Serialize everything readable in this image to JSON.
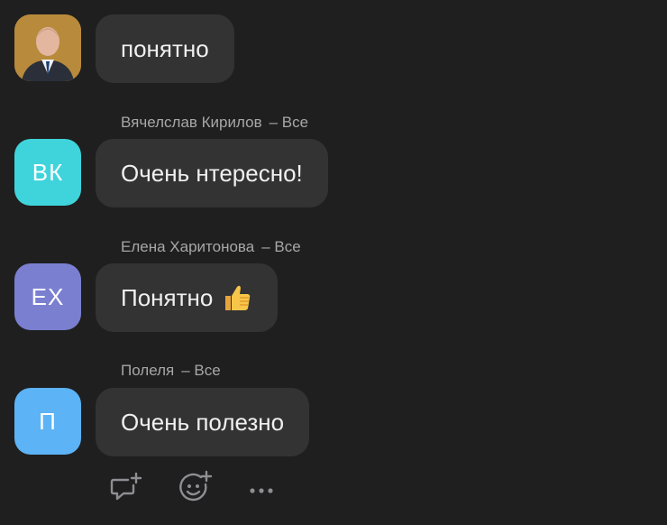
{
  "messages": [
    {
      "avatar_text": "",
      "avatar_kind": "photo",
      "text": "понятно"
    },
    {
      "author": "Вячелслав Кирилов",
      "audience": "– Все",
      "avatar_text": "ВК",
      "avatar_color": "#3fd4dc",
      "text": "Очень нтересно!"
    },
    {
      "author": "Елена Харитонова",
      "audience": "– Все",
      "avatar_text": "ЕХ",
      "avatar_color": "#7a7fd0",
      "text": "Понятно",
      "emoji": "thumbs-up-icon"
    },
    {
      "author": "Полеля",
      "audience": "– Все",
      "avatar_text": "П",
      "avatar_color": "#5cb3f5",
      "text": "Очень полезно"
    }
  ],
  "actions": [
    {
      "icon": "add-comment-icon"
    },
    {
      "icon": "add-reaction-icon"
    },
    {
      "icon": "more-icon"
    }
  ]
}
